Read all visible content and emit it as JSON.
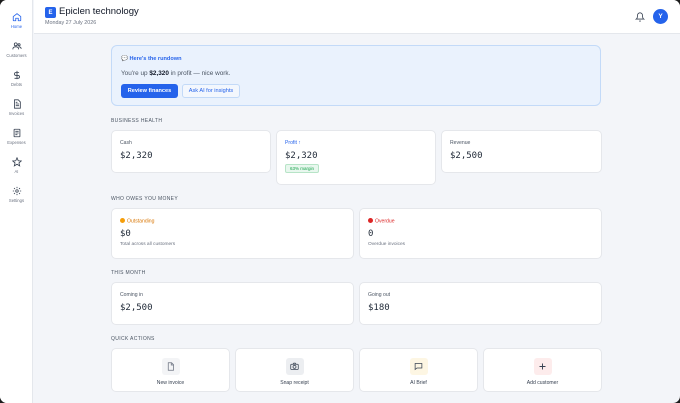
{
  "sidebar": {
    "items": [
      {
        "label": "Home",
        "icon": "home-icon",
        "active": true
      },
      {
        "label": "Customers",
        "icon": "customers-icon",
        "active": false
      },
      {
        "label": "Debts",
        "icon": "dollar-icon",
        "active": false
      },
      {
        "label": "Invoices",
        "icon": "invoice-icon",
        "active": false
      },
      {
        "label": "Expenses",
        "icon": "receipt-icon",
        "active": false
      },
      {
        "label": "AI",
        "icon": "star-icon",
        "active": false
      },
      {
        "label": "Settings",
        "icon": "gear-icon",
        "active": false
      }
    ]
  },
  "header": {
    "logo_letter": "E",
    "company": "Epiclen technology",
    "date": "Monday 27 July 2026",
    "avatar_letter": "Y"
  },
  "rundown": {
    "title": "💬 Here's the rundown",
    "text_prefix": "You're up ",
    "amount": "$2,320",
    "text_suffix": " in profit — nice work.",
    "primary_button": "Review finances",
    "secondary_button": "Ask AI for insights"
  },
  "business_health": {
    "label": "BUSINESS HEALTH",
    "cash_label": "Cash",
    "cash_value": "$2,320",
    "profit_label": "Profit ↑",
    "profit_value": "$2,320",
    "profit_margin": "63% margin",
    "revenue_label": "Revenue",
    "revenue_value": "$2,500"
  },
  "owes": {
    "label": "WHO OWES YOU MONEY",
    "outstanding_label": "Outstanding",
    "outstanding_value": "$0",
    "outstanding_sub": "Total across all customers",
    "overdue_label": "Overdue",
    "overdue_value": "0",
    "overdue_sub": "Overdue invoices"
  },
  "this_month": {
    "label": "THIS MONTH",
    "in_label": "Coming in",
    "in_value": "$2,500",
    "out_label": "Going out",
    "out_value": "$180"
  },
  "quick_actions": {
    "label": "QUICK ACTIONS",
    "items": [
      {
        "label": "New invoice",
        "icon": "document-icon"
      },
      {
        "label": "Snap receipt",
        "icon": "camera-icon"
      },
      {
        "label": "AI Brief",
        "icon": "chat-icon"
      },
      {
        "label": "Add customer",
        "icon": "plus-icon"
      }
    ]
  },
  "colors": {
    "accent": "#2563eb",
    "success": "#16a34a",
    "warning": "#d97706",
    "danger": "#dc2626"
  }
}
